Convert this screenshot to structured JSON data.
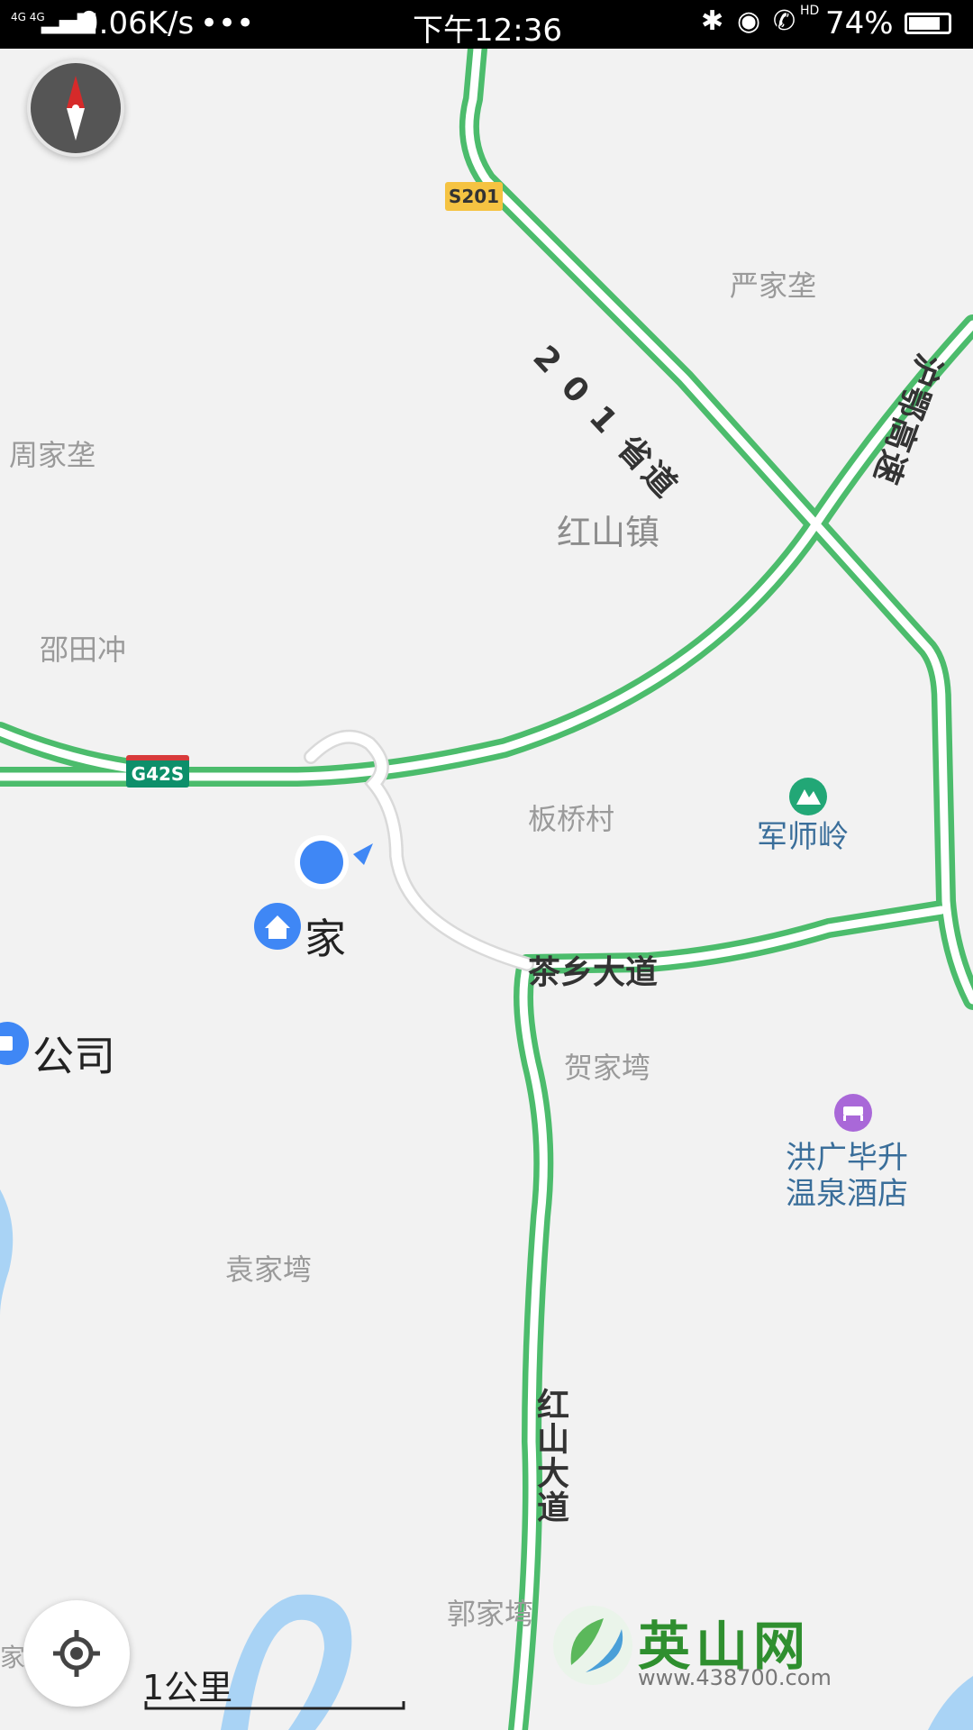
{
  "status_bar": {
    "network": "4G 4G",
    "speed": "0.06K/s",
    "more": "•••",
    "time": "下午12:36",
    "battery_pct": "74%",
    "hd_label": "HD"
  },
  "places": {
    "yanjiaping": "严家垄",
    "zhoujiaping": "周家垄",
    "hongshanzhen": "红山镇",
    "shaotianchong": "邵田冲",
    "banqiaocun": "板桥村",
    "hejiawan": "贺家塆",
    "yuanjiawan": "袁家塆",
    "guojiawan": "郭家塆",
    "edge_jia": "家"
  },
  "pois": {
    "junshiling": "军师岭",
    "hotel_line1": "洪广毕升",
    "hotel_line2": "温泉酒店",
    "home": "家",
    "company": "公司"
  },
  "roads": {
    "s201_shield": "S201",
    "g42s_shield": "G42S",
    "provincial_road_201": "2 0 1 省道",
    "hurong_expressway": "沪鄂高速",
    "chaxiang_avenue": "茶乡大道",
    "hongshan_avenue": "红山大道"
  },
  "controls": {
    "scale_label": "1公里"
  },
  "watermark": {
    "name": "英山网",
    "url": "www.438700.com"
  },
  "colors": {
    "map_bg": "#f2f2f2",
    "road_green": "#4cbc6c",
    "road_inner": "#ffffff",
    "location_blue": "#3f87f5",
    "water": "#a9d3f5"
  }
}
